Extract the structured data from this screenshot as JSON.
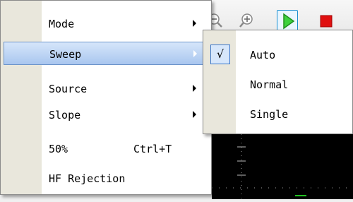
{
  "menu": {
    "items": [
      {
        "label": "Mode",
        "shortcut": "",
        "submenu": true,
        "selected": false
      },
      {
        "label": "Sweep",
        "shortcut": "",
        "submenu": true,
        "selected": true
      },
      {
        "label": "Source",
        "shortcut": "",
        "submenu": true,
        "selected": false
      },
      {
        "label": "Slope",
        "shortcut": "",
        "submenu": true,
        "selected": false
      },
      {
        "label": "50%",
        "shortcut": "Ctrl+T",
        "submenu": false,
        "selected": false
      },
      {
        "label": "HF Rejection",
        "shortcut": "",
        "submenu": false,
        "selected": false
      }
    ]
  },
  "submenu": {
    "items": [
      {
        "label": "Auto",
        "checked": true,
        "check_glyph": "√"
      },
      {
        "label": "Normal",
        "checked": false
      },
      {
        "label": "Single",
        "checked": false
      }
    ]
  },
  "toolbar": {
    "icons": [
      "zoom-out-icon",
      "zoom-in-icon",
      "run-icon",
      "stop-icon"
    ]
  },
  "colors": {
    "highlight_top": "#d6e6fa",
    "highlight_bottom": "#a9c6ef",
    "gutter": "#e9e7dc",
    "run_green": "#22b022",
    "stop_red": "#e01010"
  }
}
